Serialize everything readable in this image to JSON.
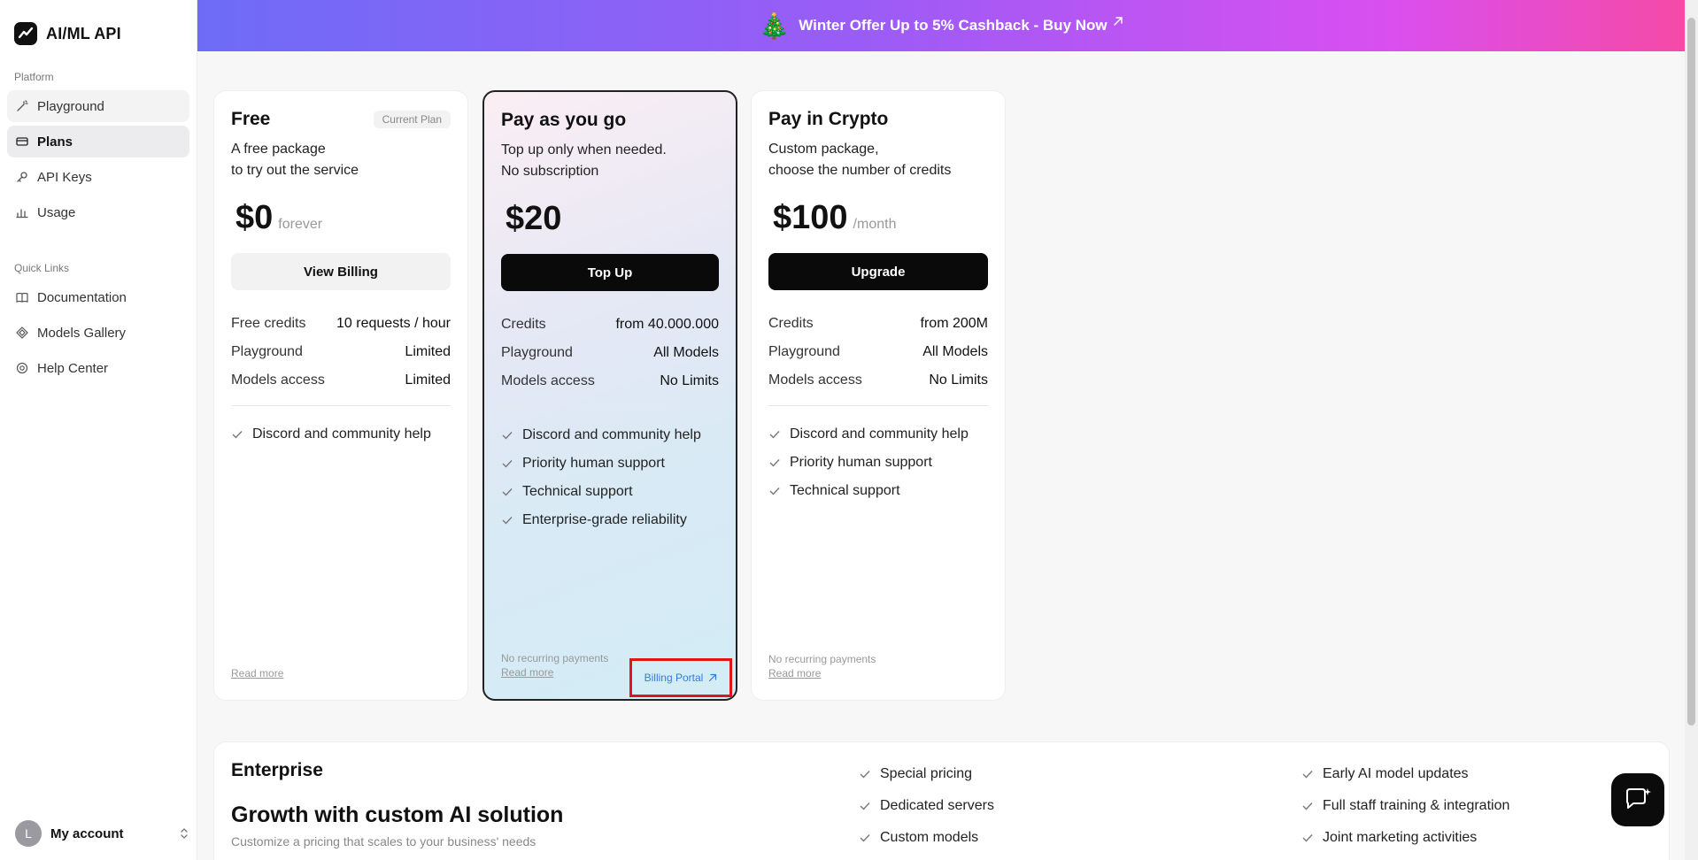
{
  "app": {
    "name": "AI/ML API"
  },
  "banner": {
    "text": "Winter Offer Up to 5% Cashback - Buy Now",
    "emoji": "🎄"
  },
  "sidebar": {
    "platform_label": "Platform",
    "platform_items": [
      {
        "label": "Playground",
        "icon": "wand-icon"
      },
      {
        "label": "Plans",
        "icon": "card-icon"
      },
      {
        "label": "API Keys",
        "icon": "key-icon"
      },
      {
        "label": "Usage",
        "icon": "bar-chart-icon"
      }
    ],
    "quick_links_label": "Quick Links",
    "quick_links": [
      {
        "label": "Documentation",
        "icon": "book-icon"
      },
      {
        "label": "Models Gallery",
        "icon": "diamond-icon"
      },
      {
        "label": "Help Center",
        "icon": "help-icon"
      }
    ],
    "account": {
      "initial": "L",
      "label": "My account"
    }
  },
  "plans": [
    {
      "title": "Free",
      "badge": "Current Plan",
      "desc_line1": "A free package",
      "desc_line2": "to try out the service",
      "price": "$0",
      "period": "forever",
      "button": "View Billing",
      "rows": [
        {
          "k": "Free credits",
          "v": "10 requests / hour"
        },
        {
          "k": "Playground",
          "v": "Limited"
        },
        {
          "k": "Models access",
          "v": "Limited"
        }
      ],
      "features": [
        "Discord and community help"
      ],
      "foot_note": "",
      "read_more": "Read more"
    },
    {
      "title": "Pay as you go",
      "desc_line1": "Top up only when needed.",
      "desc_line2": "No subscription",
      "price": "$20",
      "period": "",
      "button": "Top Up",
      "rows": [
        {
          "k": "Credits",
          "v": "from 40.000.000"
        },
        {
          "k": "Playground",
          "v": "All Models"
        },
        {
          "k": "Models access",
          "v": "No Limits"
        }
      ],
      "features": [
        "Discord and community help",
        "Priority human support",
        "Technical support",
        "Enterprise-grade reliability"
      ],
      "foot_note": "No recurring payments",
      "read_more": "Read more",
      "billing_portal": "Billing Portal"
    },
    {
      "title": "Pay in Crypto",
      "desc_line1": "Custom package,",
      "desc_line2": "choose the number of credits",
      "price": "$100",
      "period": "/month",
      "button": "Upgrade",
      "rows": [
        {
          "k": "Credits",
          "v": "from 200M"
        },
        {
          "k": "Playground",
          "v": "All Models"
        },
        {
          "k": "Models access",
          "v": "No Limits"
        }
      ],
      "features": [
        "Discord and community help",
        "Priority human support",
        "Technical support"
      ],
      "foot_note": "No recurring payments",
      "read_more": "Read more"
    }
  ],
  "enterprise": {
    "title": "Enterprise",
    "headline": "Growth with custom AI solution",
    "subtitle": "Customize a pricing that scales to your business' needs",
    "col1": [
      "Special pricing",
      "Dedicated servers",
      "Custom models"
    ],
    "col2": [
      "Early AI model updates",
      "Full staff training & integration",
      "Joint marketing activities"
    ]
  }
}
